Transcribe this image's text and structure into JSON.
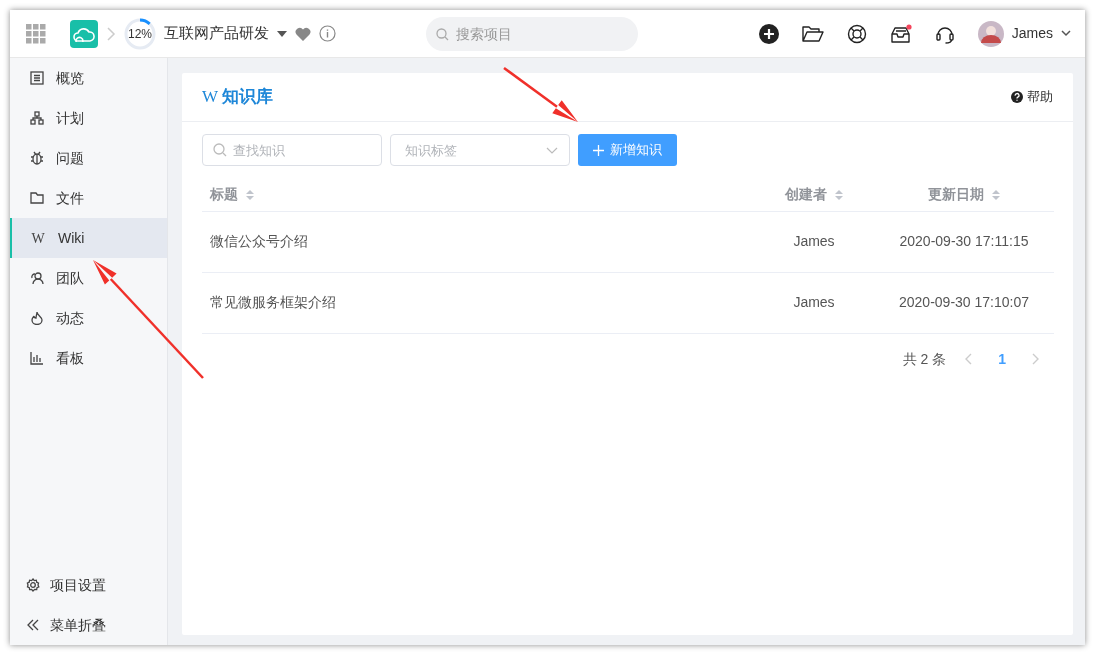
{
  "topbar": {
    "progress": {
      "text": "12%",
      "level": 0.12
    },
    "project": "互联网产品研发",
    "search": {
      "placeholder": "搜索项目"
    },
    "inbox_unread": true,
    "user": "James"
  },
  "sidebar": {
    "items": [
      {
        "label": "概览",
        "kind": "overview",
        "selected": false
      },
      {
        "label": "计划",
        "kind": "plan",
        "selected": false
      },
      {
        "label": "问题",
        "kind": "bug",
        "selected": false
      },
      {
        "label": "文件",
        "kind": "folder",
        "selected": false
      },
      {
        "label": "Wiki",
        "kind": "glyph",
        "glyph": "W",
        "selected": true
      },
      {
        "label": "团队",
        "kind": "team",
        "selected": false
      },
      {
        "label": "动态",
        "kind": "flame",
        "selected": false
      },
      {
        "label": "看板",
        "kind": "chart",
        "selected": false
      }
    ],
    "footer": [
      {
        "label": "项目设置",
        "kind": "gear"
      },
      {
        "label": "菜单折叠",
        "kind": "collapse"
      }
    ]
  },
  "page": {
    "title_glyph": "W",
    "title": "知识库",
    "help": "帮助",
    "search": {
      "placeholder": "查找知识"
    },
    "tag_select": {
      "placeholder": "知识标签"
    },
    "add_button": "新增知识",
    "table": {
      "columns": [
        "标题",
        "创建者",
        "更新日期"
      ],
      "rows": [
        [
          "微信公众号介绍",
          "James",
          "2020-09-30 17:11:15"
        ],
        [
          "常见微服务框架介绍",
          "James",
          "2020-09-30 17:10:07"
        ]
      ]
    },
    "pagination": {
      "total": "共 2 条",
      "pages": [
        {
          "label": "1",
          "selected": true
        }
      ]
    }
  }
}
